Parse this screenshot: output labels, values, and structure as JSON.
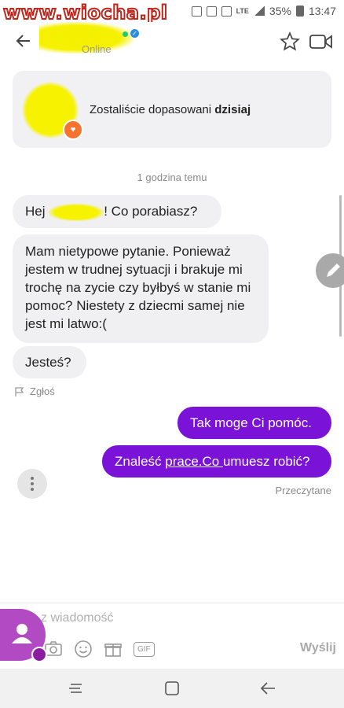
{
  "status_bar": {
    "watermark": "www.wiocha.pl",
    "network": "LTE",
    "battery": "35%",
    "time": "13:47"
  },
  "header": {
    "status": "Online",
    "icons": [
      "back-arrow-icon",
      "star-icon",
      "video-call-icon"
    ]
  },
  "match_card": {
    "text": "Zostaliście dopasowani ",
    "text_bold": "dzisiaj"
  },
  "timestamp": "1 godzina temu",
  "messages": {
    "m1_prefix": "Hej ",
    "m1_suffix": "! Co porabiasz?",
    "m2": "Mam nietypowe pytanie. Ponieważ jestem w trudnej sytuacji i brakuje mi trochę na zycie czy byłbyś w stanie mi pomoc? Niestety z dziecmi samej nie jest mi latwo:(",
    "m3": "Jesteś?",
    "m4": "Tak moge Ci pomóc.",
    "m5_prefix": "Znaleść ",
    "m5_link": "prace.Co ",
    "m5_suffix": "umuesz robić?"
  },
  "report_label": "Zgłoś",
  "read_receipt": "Przeczytane",
  "composer": {
    "placeholder": "z wiadomość",
    "send_label": "Wyślij",
    "gif_label": "GIF"
  },
  "colors": {
    "accent": "#7b12d8",
    "bubble_in": "#f0f0f2",
    "heart": "#f5732f"
  }
}
